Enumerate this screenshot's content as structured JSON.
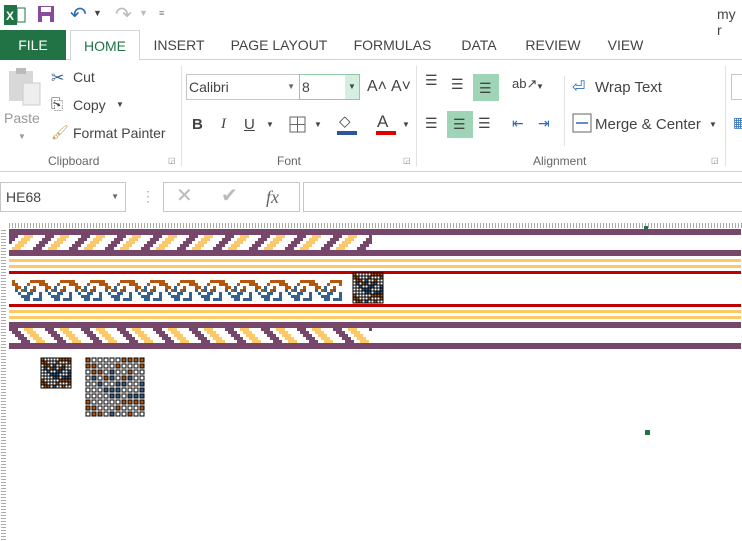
{
  "window": {
    "title": "my r"
  },
  "qat": {
    "icons": [
      "excel-logo-icon",
      "save-icon",
      "undo-icon",
      "redo-icon",
      "customize-qat-icon"
    ]
  },
  "tabs": [
    "FILE",
    "HOME",
    "INSERT",
    "PAGE LAYOUT",
    "FORMULAS",
    "DATA",
    "REVIEW",
    "VIEW"
  ],
  "clipboard": {
    "paste": "Paste",
    "cut": "Cut",
    "copy": "Copy",
    "format_painter": "Format Painter",
    "label": "Clipboard"
  },
  "font": {
    "name": "Calibri",
    "size": "8",
    "bold": "B",
    "italic": "I",
    "underline": "U",
    "label": "Font",
    "fill_color": "#2b579a",
    "font_color": "#e00000"
  },
  "alignment": {
    "wrap_text": "Wrap Text",
    "merge_center": "Merge & Center",
    "label": "Alignment"
  },
  "formula_bar": {
    "name_box": "HE68",
    "fx": "fx",
    "value": ""
  },
  "colors": {
    "purple": "#76476b",
    "yellow": "#fdc966",
    "red": "#c00000",
    "orange": "#b5560f",
    "blue": "#35608f",
    "accent": "#217346"
  }
}
